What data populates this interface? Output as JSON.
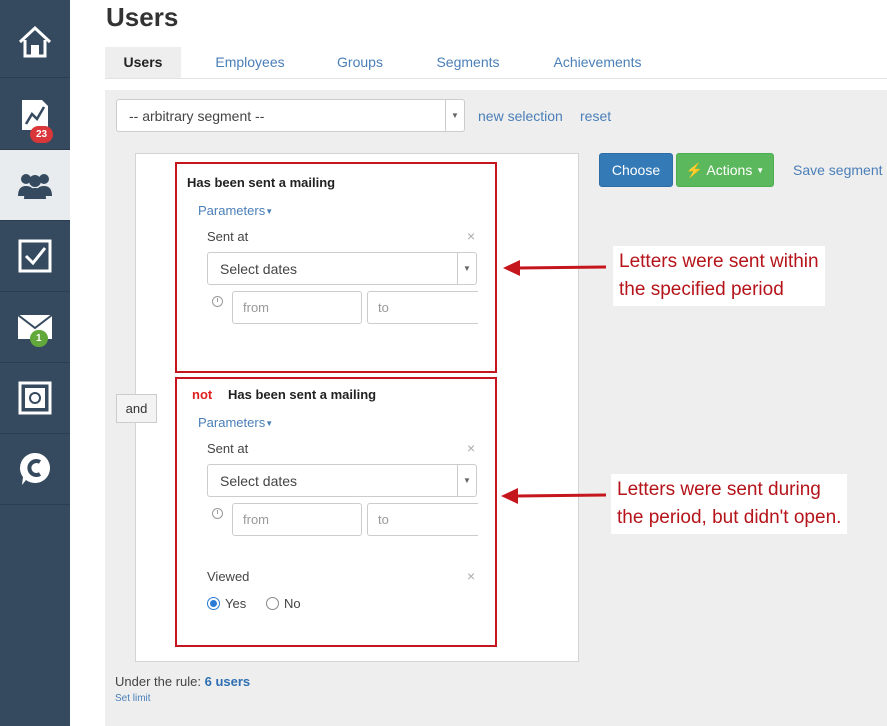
{
  "sidebar": {
    "items": [
      {
        "icon": "home-icon"
      },
      {
        "icon": "chart-icon",
        "badge": "23",
        "badge_color": "#d9373a"
      },
      {
        "icon": "users-icon",
        "active": true
      },
      {
        "icon": "checkbox-icon"
      },
      {
        "icon": "mail-icon",
        "badge": "1",
        "badge_color": "#62a83b"
      },
      {
        "icon": "safe-icon"
      },
      {
        "icon": "chat-icon"
      }
    ]
  },
  "header": {
    "title": "Users",
    "tabs": [
      {
        "label": "Users",
        "active": true
      },
      {
        "label": "Employees"
      },
      {
        "label": "Groups"
      },
      {
        "label": "Segments"
      },
      {
        "label": "Achievements"
      }
    ]
  },
  "segment": {
    "select_value": "-- arbitrary segment --",
    "new_selection": "new selection",
    "reset": "reset"
  },
  "actions": {
    "choose": "Choose",
    "actions": "Actions",
    "save_segment": "Save segment"
  },
  "logic": {
    "and": "and"
  },
  "rule1": {
    "title": "Has been sent a mailing",
    "parameters": "Parameters",
    "sent_at": "Sent at",
    "select_dates": "Select dates",
    "from_placeholder": "from",
    "to_placeholder": "to"
  },
  "rule2": {
    "not": "not",
    "title": "Has been sent a mailing",
    "parameters": "Parameters",
    "sent_at": "Sent at",
    "select_dates": "Select dates",
    "from_placeholder": "from",
    "to_placeholder": "to",
    "viewed": "Viewed",
    "yes": "Yes",
    "no": "No",
    "viewed_value": "Yes"
  },
  "annotations": {
    "a1_line1": "Letters were sent within",
    "a1_line2": "the specified period",
    "a2_line1": "Letters were sent during",
    "a2_line2": "the period, but didn't open."
  },
  "footer": {
    "rule_prefix": "Under the rule:",
    "rule_count": "6 users",
    "set_limit": "Set limit"
  },
  "colors": {
    "sidebar": "#354a5f",
    "highlight_border": "#c4161c",
    "annotation_text": "#b5141a",
    "primary": "#337ab7",
    "success": "#5cb85c",
    "link": "#4a7fb8"
  }
}
